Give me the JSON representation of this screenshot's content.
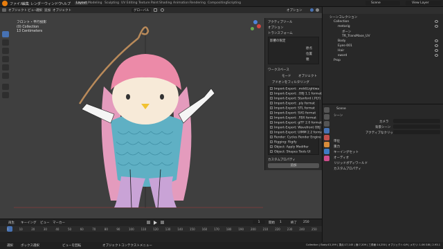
{
  "menus": [
    "ファイル",
    "編集",
    "レンダー",
    "ウィンドウ",
    "ヘルプ"
  ],
  "workspaces": [
    "Layout",
    "Modeling",
    "Sculpting",
    "UV Editing",
    "Texture Paint",
    "Shading",
    "Animation",
    "Rendering",
    "Compositing",
    "Scripting"
  ],
  "header": {
    "scene": "Scene",
    "view_layer": "View Layer"
  },
  "viewport": {
    "header_items": [
      "オブジェクト",
      "ビュー",
      "選択",
      "追加",
      "オブジェクト"
    ],
    "header_right": [
      "グローバル",
      "オプション"
    ],
    "overlay_lines": [
      "フロント・平行投影",
      "(0) Collection",
      "13 Centimeters"
    ]
  },
  "npanel": {
    "active_tool": "アクティブツール",
    "options": "オプション",
    "transform": "トランスフォーム",
    "transform_header": "影響の限定",
    "transform_rows": [
      "原点",
      "位置",
      "親"
    ],
    "workspace": "ワークスペース",
    "mode_label": "モード",
    "mode_value": "オブジェクト",
    "addon_filter": "アドオンをフィルタリング",
    "addons": [
      "Import-Export: .mdd(Lightwa",
      "Import-Export: .OBJ 1.1 format",
      "Import-Export: Stanford (.PLY)",
      "Import-Export: .ply format",
      "Import-Export: STL format",
      "Import-Export: SVG format",
      "Import-Export: .FBX format",
      "Import-Export: glTF 2.0 format",
      "Import-Export: Wavefront OBJ",
      "Import-Export: UIMM 2.2 format",
      "Render: Cycles Render Engine",
      "Rigging: Rigify",
      "Object: Apply Modifier",
      "Object: Shapes Tools UI"
    ],
    "custom_props": "カスタムプロパティ",
    "add_button": "追加"
  },
  "outliner": {
    "title": "シーンコレクション",
    "items": [
      {
        "label": "Collection",
        "indent": 0
      },
      {
        "label": "metarig",
        "indent": 1
      },
      {
        "label": "ボーン",
        "indent": 2
      },
      {
        "label": "Tft_TransMase_UV",
        "indent": 2
      },
      {
        "label": "Body",
        "indent": 1
      },
      {
        "label": "Eyes-001",
        "indent": 1
      },
      {
        "label": "Hair",
        "indent": 1
      },
      {
        "label": "sword",
        "indent": 1
      },
      {
        "label": "Prop",
        "indent": 0
      }
    ]
  },
  "properties": {
    "scene_name": "Scene",
    "section": "シーン",
    "camera_label": "カメラ",
    "bg_scene_label": "背景シーン",
    "active_clip_label": "アクティブなクリップ",
    "sections": [
      "単位",
      "重力",
      "キーイングセット",
      "オーディオ",
      "リジッドボディワールド",
      "カスタムプロパティ"
    ]
  },
  "timeline": {
    "items": [
      "再生",
      "キーイング",
      "ビュー",
      "マーカー"
    ],
    "current_frame": "1",
    "start_label": "開始",
    "start": "1",
    "end_label": "終了",
    "end": "250",
    "ticks": [
      "0",
      "10",
      "20",
      "30",
      "40",
      "50",
      "60",
      "70",
      "80",
      "90",
      "100",
      "110",
      "120",
      "130",
      "140",
      "150",
      "160",
      "170",
      "180",
      "190",
      "200",
      "210",
      "220",
      "230",
      "240",
      "250"
    ]
  },
  "status": {
    "left": [
      "選択",
      "ボックス選択",
      "ビューを回転",
      "オブジェクトコンテクストメニュー"
    ],
    "right": "Collection | Body:43,199 | 頂点:17,145 | 面:7,209 | 三角面:14,250 | オブジェクト:0/9 | メモリ: 1.06 GiB | 2.93.1"
  },
  "colors": {
    "accent": "#4772b3",
    "active_tool": "#4772b3",
    "workspace_active": "#3d3d3d"
  }
}
